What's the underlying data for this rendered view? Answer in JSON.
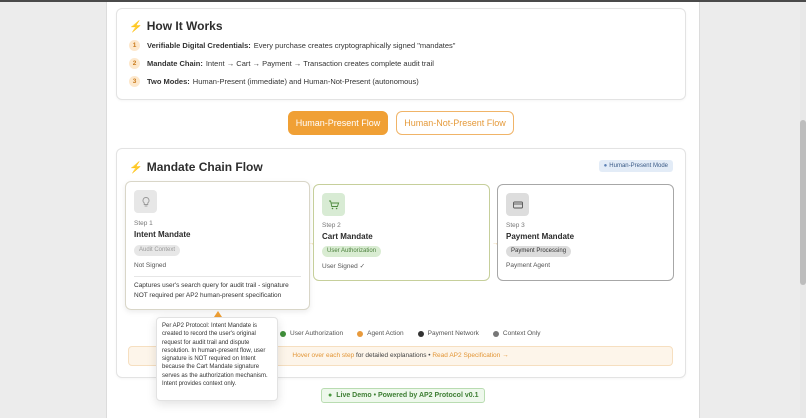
{
  "how_it_works": {
    "title": "How It Works",
    "items": [
      {
        "number": "1",
        "title": "Verifiable Digital Credentials:",
        "text": "Every purchase creates cryptographically signed \"mandates\""
      },
      {
        "number": "2",
        "title": "Mandate Chain:",
        "text": "Intent → Cart → Payment → Transaction creates complete audit trail"
      },
      {
        "number": "3",
        "title": "Two Modes:",
        "text": "Human-Present (immediate) and Human-Not-Present (autonomous)"
      }
    ]
  },
  "mode_buttons": {
    "human_present": "Human-Present Flow",
    "human_not_present": "Human-Not-Present Flow"
  },
  "flow": {
    "title": "Mandate Chain Flow",
    "mode_badge": "Human-Present Mode",
    "steps": [
      {
        "label": "Step 1",
        "name": "Intent Mandate",
        "tag": "Audit Context",
        "status": "Not Signed",
        "icon": "lightbulb-icon",
        "description": "Captures user's search query for audit trail - signature NOT required per AP2 human-present specification"
      },
      {
        "label": "Step 2",
        "name": "Cart Mandate",
        "tag": "User Authorization",
        "status": "User Signed ✓",
        "icon": "cart-icon"
      },
      {
        "label": "Step 3",
        "name": "Payment Mandate",
        "tag": "Payment Processing",
        "status": "Payment Agent",
        "icon": "credit-card-icon"
      }
    ]
  },
  "legend": [
    {
      "label": "User Authorization",
      "color": "#3f8f3a"
    },
    {
      "label": "Agent Action",
      "color": "#e89a3c"
    },
    {
      "label": "Payment Network",
      "color": "#333333"
    },
    {
      "label": "Context Only",
      "color": "#777777"
    }
  ],
  "hover_bar": {
    "highlight": "Hover over each step",
    "text": " for detailed explanations • ",
    "link": "Read AP2 Specification →"
  },
  "tooltip": {
    "text": "Per AP2 Protocol: Intent Mandate is created to record the user's original request for audit trail and dispute resolution. In human-present flow, user signature is NOT required on Intent because the Cart Mandate signature serves as the authorization mechanism. Intent provides context only."
  },
  "footer": {
    "text": "Live Demo • Powered by AP2 Protocol v0.1"
  },
  "colors": {
    "accent": "#f0a035",
    "green": "#3f8f3a"
  }
}
